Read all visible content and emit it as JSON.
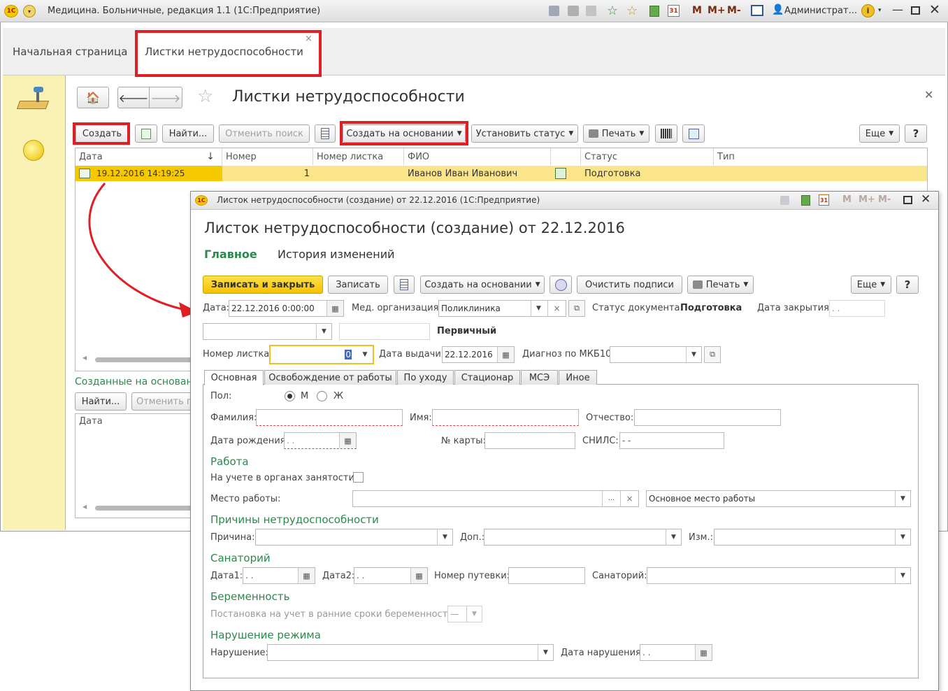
{
  "app": {
    "title": "Медицина. Больничные, редакция 1.1  (1С:Предприятие)",
    "user": "Администрат...",
    "memory_buttons": [
      "M",
      "M+",
      "M-"
    ]
  },
  "tabs": {
    "home": "Начальная страница",
    "active": "Листки нетрудоспособности",
    "close_glyph": "×"
  },
  "list": {
    "title": "Листки нетрудоспособности",
    "toolbar": {
      "create": "Создать",
      "find": "Найти...",
      "cancel_search": "Отменить поиск",
      "create_based_on": "Создать на основании",
      "set_status": "Установить статус",
      "print": "Печать",
      "more": "Еще",
      "help": "?"
    },
    "columns": [
      "Дата",
      "Номер",
      "Номер листка",
      "ФИО",
      "",
      "Статус",
      "Тип"
    ],
    "sort_glyph": "↓",
    "rows": [
      {
        "date": "19.12.2016 14:19:25",
        "number": "1",
        "sheet_number": "",
        "fio": "Иванов Иван Иванович",
        "status": "Подготовка",
        "type": ""
      }
    ],
    "created_based_title": "Созданные на основании",
    "created_based_find": "Найти...",
    "created_based_cancel": "Отменить поиск",
    "created_based_col": "Дата"
  },
  "form": {
    "window_title": "Листок нетрудоспособности (создание) от 22.12.2016  (1С:Предприятие)",
    "title": "Листок нетрудоспособности (создание) от 22.12.2016",
    "nav": {
      "main": "Главное",
      "history": "История изменений"
    },
    "toolbar": {
      "save_close": "Записать и закрыть",
      "save": "Записать",
      "create_based_on": "Создать на основании",
      "clear_signatures": "Очистить подписи",
      "print": "Печать",
      "more": "Еще",
      "help": "?"
    },
    "date_label": "Дата:",
    "date_value": "22.12.2016  0:00:00",
    "med_org_label": "Мед. организация:",
    "med_org_value": "Поликлиника",
    "doc_status_label": "Статус документа:",
    "doc_status_value": "Подготовка",
    "close_date_label": "Дата закрытия:",
    "close_date_value": " .  .",
    "primary_label": "Первичный",
    "sheet_no_label": "Номер листка:",
    "sheet_no_value": "0",
    "issue_date_label": "Дата выдачи:",
    "issue_date_value": "22.12.2016",
    "diagnosis_label": "Диагноз по МКБ10:",
    "tabs": [
      "Основная",
      "Освобождение от работы",
      "По уходу",
      "Стационар",
      "МСЭ",
      "Иное"
    ],
    "sex_label": "Пол:",
    "sex_m": "М",
    "sex_f": "Ж",
    "surname_label": "Фамилия:",
    "name_label": "Имя:",
    "patronymic_label": "Отчество:",
    "birth_label": "Дата рождения:",
    "birth_value": " .  .",
    "card_label": "№ карты:",
    "snils_label": "СНИЛС:",
    "snils_value": "  -  -",
    "work_group": "Работа",
    "employment_label": "На учете в органах занятости:",
    "workplace_label": "Место работы:",
    "workplace_type": "Основное место работы",
    "causes_group": "Причины нетрудоспособности",
    "cause_label": "Причина:",
    "add_label": "Доп.:",
    "change_label": "Изм.:",
    "sanatorium_group": "Санаторий",
    "date1_label": "Дата1:",
    "date1_value": " .  .",
    "date2_label": "Дата2:",
    "date2_value": " .  .",
    "voucher_label": "Номер путевки:",
    "sanatorium_label": "Санаторий:",
    "pregnancy_group": "Беременность",
    "pregnancy_label": "Постановка на учет в ранние сроки беременности:",
    "pregnancy_value": "—",
    "regime_group": "Нарушение режима",
    "violation_label": "Нарушение:",
    "violation_date_label": "Дата нарушения:",
    "violation_date_value": " .  ."
  },
  "colors": {
    "accent": "#e01e26",
    "group": "#2b8a4b",
    "selected_row": "#fbe58a",
    "primary_button": "#f5c800"
  }
}
